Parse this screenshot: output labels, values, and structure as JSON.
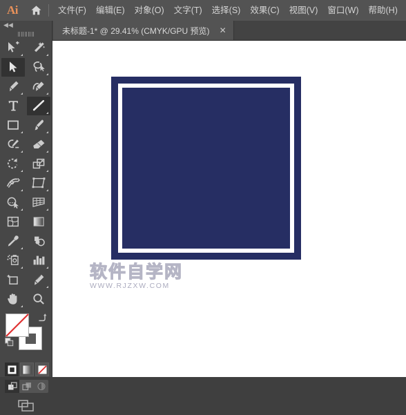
{
  "app": {
    "name": "Ai",
    "logo_color": "#e8915a"
  },
  "menubar": {
    "home_icon": "home-icon",
    "items": [
      {
        "label": "文件(F)",
        "name": "menu-file"
      },
      {
        "label": "编辑(E)",
        "name": "menu-edit"
      },
      {
        "label": "对象(O)",
        "name": "menu-object"
      },
      {
        "label": "文字(T)",
        "name": "menu-type"
      },
      {
        "label": "选择(S)",
        "name": "menu-select"
      },
      {
        "label": "效果(C)",
        "name": "menu-effect"
      },
      {
        "label": "视图(V)",
        "name": "menu-view"
      },
      {
        "label": "窗口(W)",
        "name": "menu-window"
      },
      {
        "label": "帮助(H)",
        "name": "menu-help"
      }
    ]
  },
  "tabbar": {
    "tab_title": "未标题-1* @ 29.41% (CMYK/GPU 预览)",
    "close_label": "✕",
    "document_name": "未标题-1*",
    "zoom_level": "29.41%",
    "color_mode": "CMYK/GPU 预览"
  },
  "toolpanel": {
    "collapse_label": "◀◀",
    "tools": [
      {
        "name": "selection-add-icon",
        "label": "选择并添加",
        "active": false,
        "corner": true
      },
      {
        "name": "magic-wand-icon",
        "label": "魔棒工具",
        "active": false,
        "corner": true
      },
      {
        "name": "selection-arrow-icon",
        "label": "选择工具",
        "active": true,
        "corner": false
      },
      {
        "name": "lasso-icon",
        "label": "套索工具",
        "active": false,
        "corner": true
      },
      {
        "name": "pen-icon",
        "label": "钢笔工具",
        "active": false,
        "corner": true
      },
      {
        "name": "curvature-icon",
        "label": "曲率工具",
        "active": false,
        "corner": true
      },
      {
        "name": "type-icon",
        "label": "文字工具",
        "active": false,
        "corner": false
      },
      {
        "name": "line-segment-icon",
        "label": "直线段工具",
        "active": true,
        "corner": true
      },
      {
        "name": "rectangle-icon",
        "label": "矩形工具",
        "active": false,
        "corner": true
      },
      {
        "name": "paintbrush-icon",
        "label": "画笔工具",
        "active": false,
        "corner": true
      },
      {
        "name": "shaper-icon",
        "label": "Shaper 工具",
        "active": false,
        "corner": true
      },
      {
        "name": "eraser-icon",
        "label": "橡皮擦工具",
        "active": false,
        "corner": true
      },
      {
        "name": "rotate-icon",
        "label": "旋转工具",
        "active": false,
        "corner": true
      },
      {
        "name": "scale-icon",
        "label": "比例缩放工具",
        "active": false,
        "corner": true
      },
      {
        "name": "width-icon",
        "label": "宽度工具",
        "active": false,
        "corner": true
      },
      {
        "name": "free-transform-icon",
        "label": "自由变换工具",
        "active": false,
        "corner": true
      },
      {
        "name": "shape-builder-icon",
        "label": "形状生成器",
        "active": false,
        "corner": true
      },
      {
        "name": "perspective-grid-icon",
        "label": "透视网格工具",
        "active": false,
        "corner": true
      },
      {
        "name": "mesh-icon",
        "label": "网格工具",
        "active": false,
        "corner": false
      },
      {
        "name": "gradient-icon",
        "label": "渐变工具",
        "active": false,
        "corner": false
      },
      {
        "name": "eyedropper-icon",
        "label": "吸管工具",
        "active": false,
        "corner": true
      },
      {
        "name": "blend-icon",
        "label": "混合工具",
        "active": false,
        "corner": false
      },
      {
        "name": "symbol-sprayer-icon",
        "label": "符号喷枪工具",
        "active": false,
        "corner": true
      },
      {
        "name": "column-graph-icon",
        "label": "柱形图工具",
        "active": false,
        "corner": true
      },
      {
        "name": "artboard-icon",
        "label": "画板工具",
        "active": false,
        "corner": false
      },
      {
        "name": "slice-icon",
        "label": "切片工具",
        "active": false,
        "corner": true
      },
      {
        "name": "hand-icon",
        "label": "抓手工具",
        "active": false,
        "corner": true
      },
      {
        "name": "zoom-icon",
        "label": "缩放工具",
        "active": false,
        "corner": false
      }
    ],
    "color_controls": {
      "fill_label": "填色",
      "fill_color": "#ffffff",
      "fill_is_none": true,
      "stroke_label": "描边",
      "stroke_color": "#ffffff",
      "swap_label": "互换填色和描边",
      "default_label": "默认填色和描边"
    },
    "color_modes": [
      {
        "name": "color-mode-solid",
        "label": "颜色",
        "active": true
      },
      {
        "name": "color-mode-gradient",
        "label": "渐变",
        "active": false
      },
      {
        "name": "color-mode-none",
        "label": "无",
        "active": false
      }
    ],
    "draw_modes": [
      {
        "name": "draw-normal",
        "label": "正常绘图",
        "active": true
      },
      {
        "name": "draw-behind",
        "label": "背面绘图",
        "active": false
      },
      {
        "name": "draw-inside",
        "label": "内部绘图",
        "active": false
      }
    ],
    "screen_mode": {
      "name": "screen-mode-button",
      "label": "更改屏幕模式"
    }
  },
  "canvas": {
    "background": "#ffffff",
    "artwork": {
      "name": "navy-square-with-white-inset-border",
      "outer_color": "#262e63",
      "band_color": "#ffffff",
      "inner_color": "#262e63"
    },
    "watermark": {
      "main": "软件自学网",
      "sub": "WWW.RJZXW.COM"
    }
  }
}
